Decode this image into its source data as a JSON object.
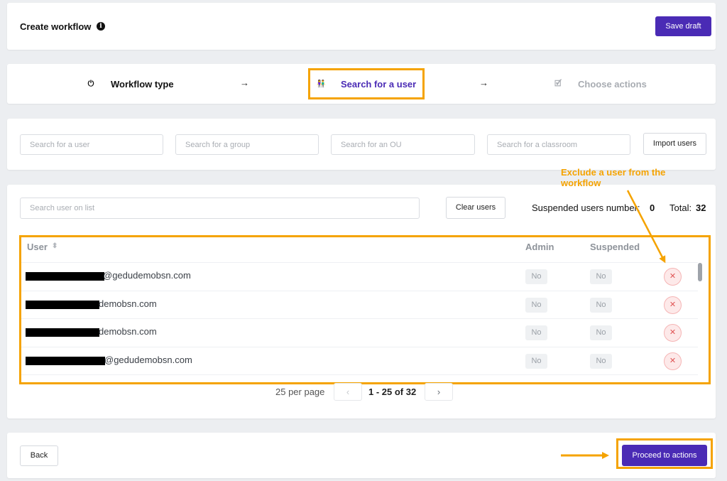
{
  "header": {
    "title": "Create workflow",
    "info_icon": "i",
    "save_label": "Save draft"
  },
  "stepper": {
    "steps": [
      {
        "label": "Workflow type",
        "icon": "power-icon",
        "glyph": "⏻",
        "state": "done"
      },
      {
        "label": "Search for a user",
        "icon": "users-icon",
        "glyph": "👫",
        "state": "active"
      },
      {
        "label": "Choose actions",
        "icon": "checklist-icon",
        "glyph": "🗹",
        "state": "upcoming"
      }
    ],
    "arrow": "→"
  },
  "search": {
    "user_placeholder": "Search for a user",
    "group_placeholder": "Search for a group",
    "ou_placeholder": "Search for an OU",
    "classroom_placeholder": "Search for a classroom",
    "import_label": "Import users"
  },
  "list": {
    "search_placeholder": "Search user on list",
    "clear_label": "Clear users",
    "suspended_label": "Suspended users number:",
    "suspended_count": "0",
    "total_label": "Total:",
    "total_count": "32",
    "columns": {
      "user": "User",
      "sort_icon": "⬍",
      "admin": "Admin",
      "suspended": "Suspended"
    },
    "rows": [
      {
        "email": "@gedudemobsn.com",
        "admin": "No",
        "suspended": "No",
        "remove": "✕"
      },
      {
        "email": "demobsn.com",
        "admin": "No",
        "suspended": "No",
        "remove": "✕"
      },
      {
        "email": "demobsn.com",
        "admin": "No",
        "suspended": "No",
        "remove": "✕"
      },
      {
        "email": "@gedudemobsn.com",
        "admin": "No",
        "suspended": "No",
        "remove": "✕"
      }
    ]
  },
  "pagination": {
    "per_page": "25 per page",
    "prev": "‹",
    "range": "1 - 25 of 32",
    "next": "›"
  },
  "footer": {
    "back_label": "Back",
    "proceed_label": "Proceed to actions"
  },
  "annotations": {
    "exclude_note": "Exclude a user from the workflow"
  },
  "colors": {
    "primary": "#4a2bb5",
    "highlight": "#f5a300",
    "danger": "#e05555"
  }
}
